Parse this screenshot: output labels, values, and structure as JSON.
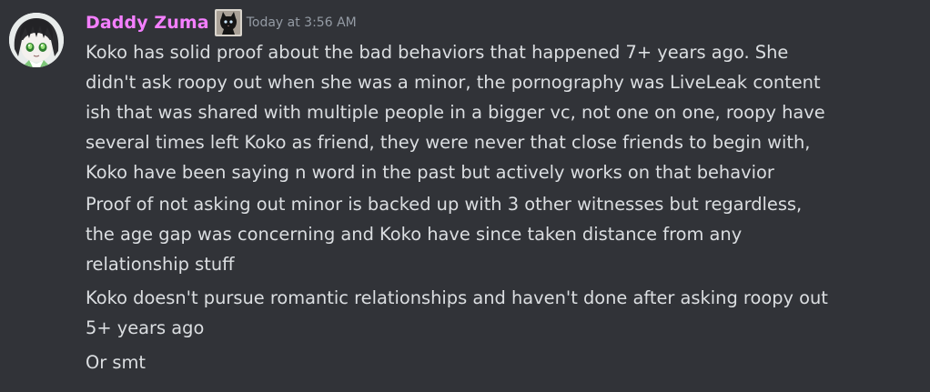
{
  "author": {
    "name": "Daddy Zuma",
    "name_color": "#f47fff",
    "avatar": "anime-avatar-icon",
    "role_icon": "cat-emoji-icon"
  },
  "timestamp": "Today at 3:56 AM",
  "messages": [
    "Koko has solid proof about the bad behaviors that happened 7+ years ago. She\ndidn't ask roopy out when she was a minor, the pornography was LiveLeak content\nish that was shared with multiple people in a bigger vc, not one on one, roopy have\nseveral times left Koko as friend, they were never that close friends to begin with,\nKoko have been saying n word in the past but actively works on that behavior",
    "Proof of not asking out minor is backed up with 3 other witnesses but regardless,\nthe age gap was concerning and Koko have since taken distance from any\nrelationship stuff",
    "Koko doesn't pursue romantic relationships and haven't done after asking roopy out\n5+ years ago",
    "Or smt"
  ],
  "colors": {
    "background": "#313338",
    "text": "#dbdee1",
    "timestamp": "#949ba4"
  }
}
